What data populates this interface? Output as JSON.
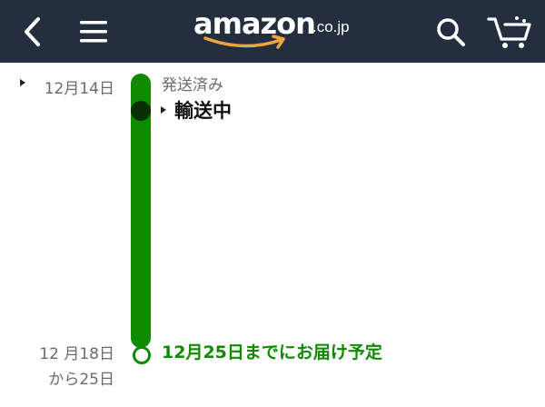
{
  "header": {
    "logo_word": "amazon",
    "logo_tld": ".co.jp",
    "icons": {
      "back": "chevron-left-icon",
      "menu": "hamburger-menu-icon",
      "search": "search-icon",
      "cart": "cart-icon"
    },
    "background_color": "#232f3e",
    "smile_color": "#f0a53c"
  },
  "timeline": {
    "events": [
      {
        "date": "12月14日",
        "label": "発送済み",
        "status": "輸送中"
      }
    ],
    "estimate": {
      "date_line1": "12 月18日",
      "date_line2": "から25日",
      "text": "12月25日までにお届け予定"
    },
    "accent_color": "#108a00"
  }
}
